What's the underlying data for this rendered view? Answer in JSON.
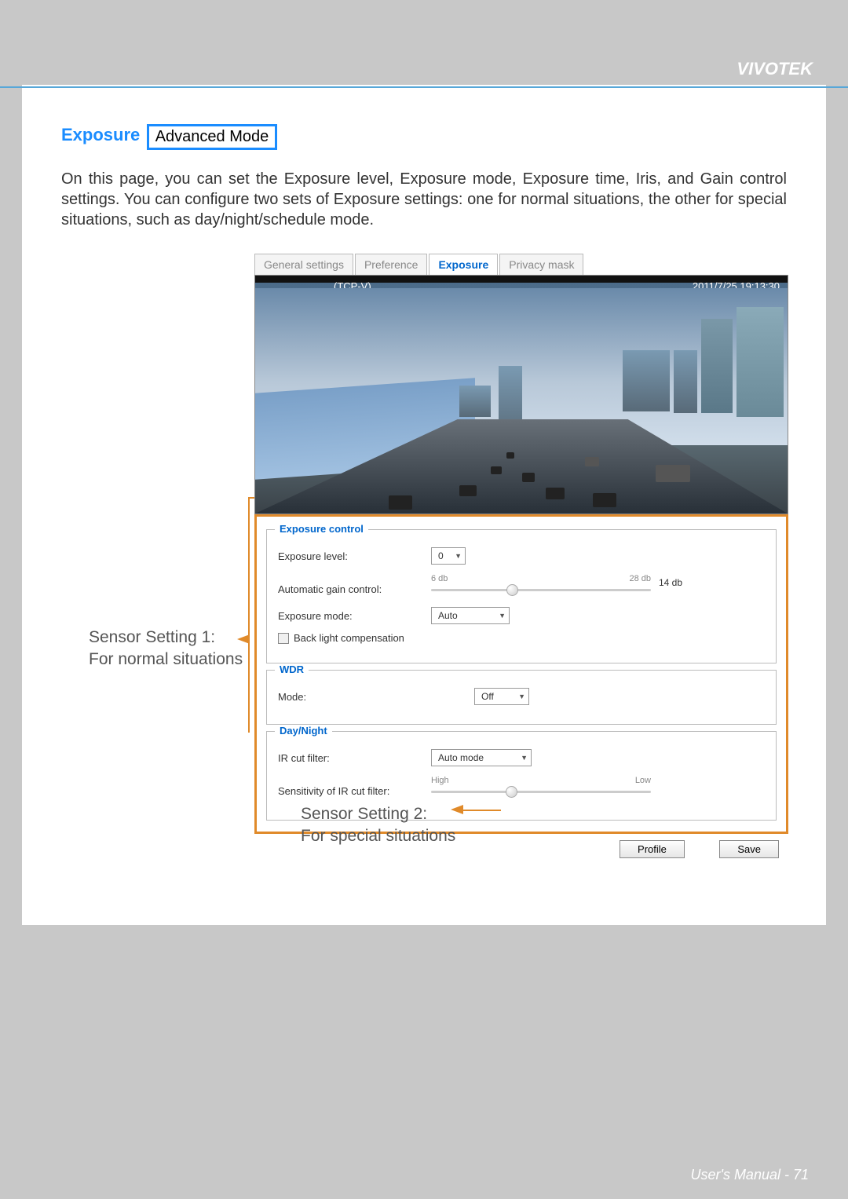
{
  "brand": "VIVOTEK",
  "section": {
    "title": "Exposure",
    "badge": "Advanced Mode"
  },
  "paragraph": "On this page, you can set the Exposure level, Exposure mode, Exposure time, Iris, and Gain control settings. You can configure two sets of Exposure settings: one for normal situations, the other for special situations, such as day/night/schedule mode.",
  "callouts": {
    "c1a": "Sensor Setting 1:",
    "c1b": "For normal situations",
    "c2a": "Sensor Setting 2:",
    "c2b": "For special situations"
  },
  "tabs": {
    "general": "General settings",
    "preference": "Preference",
    "exposure": "Exposure",
    "privacy": "Privacy mask"
  },
  "preview": {
    "label": "(TCP-V)",
    "timestamp": "2011/7/25 19:13:30"
  },
  "exposure": {
    "legend": "Exposure control",
    "level_label": "Exposure level:",
    "level_value": "0",
    "agc_label": "Automatic gain control:",
    "agc_low": "6 db",
    "agc_high": "28 db",
    "agc_value": "14 db",
    "mode_label": "Exposure mode:",
    "mode_value": "Auto",
    "blc_label": "Back light compensation"
  },
  "wdr": {
    "legend": "WDR",
    "mode_label": "Mode:",
    "mode_value": "Off"
  },
  "daynight": {
    "legend": "Day/Night",
    "ircut_label": "IR cut filter:",
    "ircut_value": "Auto mode",
    "sens_label": "Sensitivity of IR cut filter:",
    "sens_low": "High",
    "sens_high": "Low"
  },
  "buttons": {
    "profile": "Profile",
    "save": "Save"
  },
  "footer": "User's Manual - 71"
}
